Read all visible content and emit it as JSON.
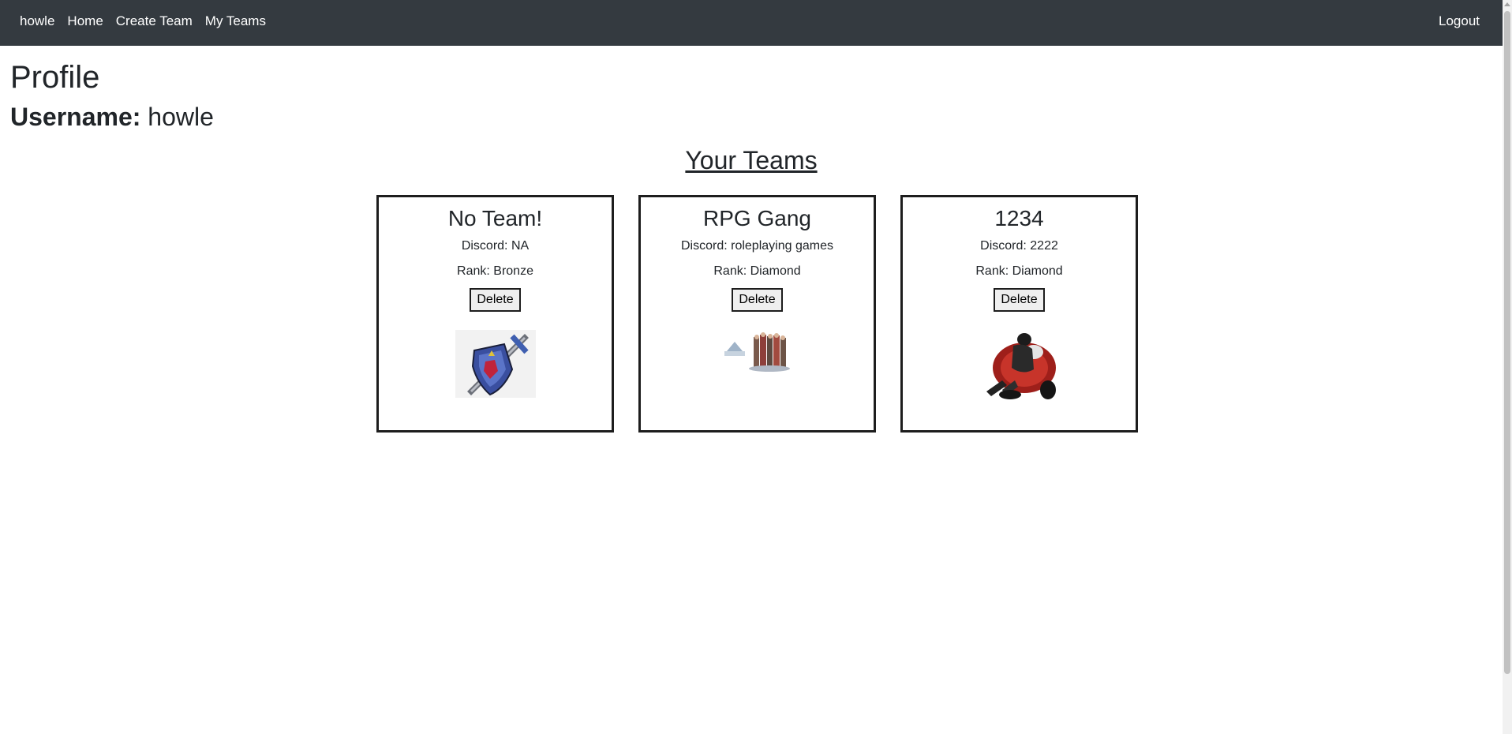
{
  "navbar": {
    "brand": "howle",
    "links": [
      "Home",
      "Create Team",
      "My Teams"
    ],
    "logout": "Logout"
  },
  "profile": {
    "title": "Profile",
    "username_label": "Username:",
    "username_value": "howle"
  },
  "teams_heading": "Your Teams",
  "teams": [
    {
      "name": "No Team!",
      "discord": "Discord: NA",
      "rank": "Rank: Bronze",
      "delete_label": "Delete",
      "image": "shield-sword-icon"
    },
    {
      "name": "RPG Gang",
      "discord": "Discord: roleplaying games",
      "rank": "Rank: Diamond",
      "delete_label": "Delete",
      "image": "rpg-party-image"
    },
    {
      "name": "1234",
      "discord": "Discord: 2222",
      "rank": "Rank: Diamond",
      "delete_label": "Delete",
      "image": "red-motorcycle-rider-image"
    }
  ],
  "colors": {
    "navbar_bg": "#343a40",
    "card_border": "#1d1d1d"
  }
}
